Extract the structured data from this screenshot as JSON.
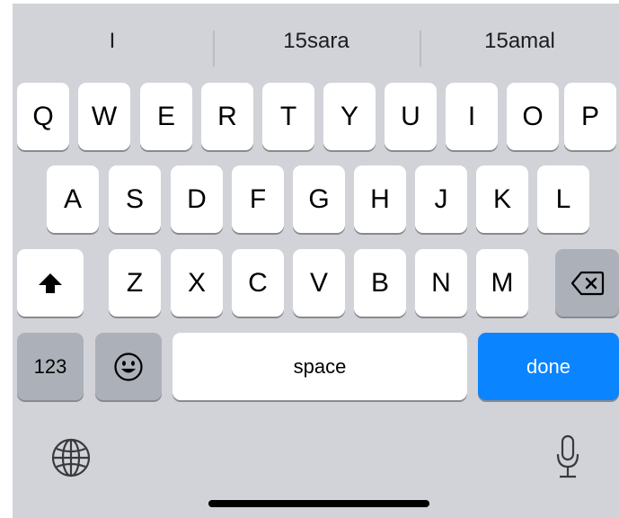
{
  "suggestions": [
    "I",
    "15sara",
    "15amal"
  ],
  "rows": [
    [
      "Q",
      "W",
      "E",
      "R",
      "T",
      "Y",
      "U",
      "I",
      "O",
      "P"
    ],
    [
      "A",
      "S",
      "D",
      "F",
      "G",
      "H",
      "J",
      "K",
      "L"
    ],
    [
      "Z",
      "X",
      "C",
      "V",
      "B",
      "N",
      "M"
    ]
  ],
  "keys": {
    "numbers_label": "123",
    "space_label": "space",
    "done_label": "done"
  },
  "icons": {
    "shift": "shift-arrow-up-icon",
    "backspace": "backspace-icon",
    "emoji": "emoji-face-icon",
    "globe": "globe-icon",
    "mic": "microphone-icon"
  },
  "colors": {
    "keyboard_background": "#d1d3d9",
    "key_light": "#ffffff",
    "key_dark": "#acb1b9",
    "done_accent": "#0a84ff"
  }
}
